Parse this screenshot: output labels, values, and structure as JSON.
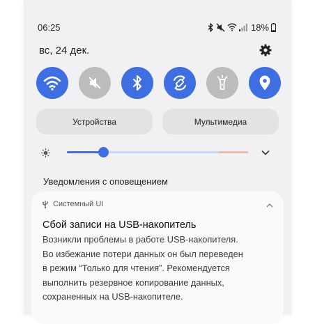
{
  "status_bar": {
    "time": "06:25",
    "battery": "18%",
    "icons": [
      "bluetooth-icon",
      "mute-icon",
      "wifi-icon",
      "signal-icon",
      "battery-icon"
    ]
  },
  "header": {
    "date": "вс, 24 дек.",
    "settings_icon": "gear-icon"
  },
  "quick_toggles": [
    {
      "name": "wifi",
      "icon": "wifi-icon",
      "state": "on"
    },
    {
      "name": "sound",
      "icon": "mute-icon",
      "state": "off"
    },
    {
      "name": "bluetooth",
      "icon": "bluetooth-icon",
      "state": "on"
    },
    {
      "name": "auto-rotate",
      "icon": "rotate-icon",
      "state": "on"
    },
    {
      "name": "flashlight",
      "icon": "flashlight-icon",
      "state": "off"
    },
    {
      "name": "location",
      "icon": "location-icon",
      "state": "on"
    }
  ],
  "buttons": {
    "devices": "Устройства",
    "media": "Мультимедиа"
  },
  "brightness": {
    "level": 0.2
  },
  "notifications": {
    "section_title": "Уведомления с оповещением",
    "card": {
      "app_name": "Системный UI",
      "title": "Сбой записи на USB-накопитель",
      "body_lines": [
        "Возникли проблемы в работе USB-накопителя.",
        "Во избежание потери данных он был переведен",
        "в режим “Только для чтения”. Рекомендуется",
        "выполнить резервное копирование данных,",
        "сохраненных на USB-накопителе."
      ]
    }
  },
  "colors": {
    "accent": "#3d6fe3",
    "toggle_off": "#bcbcbc",
    "panel_bg": "#f1f1f3"
  }
}
